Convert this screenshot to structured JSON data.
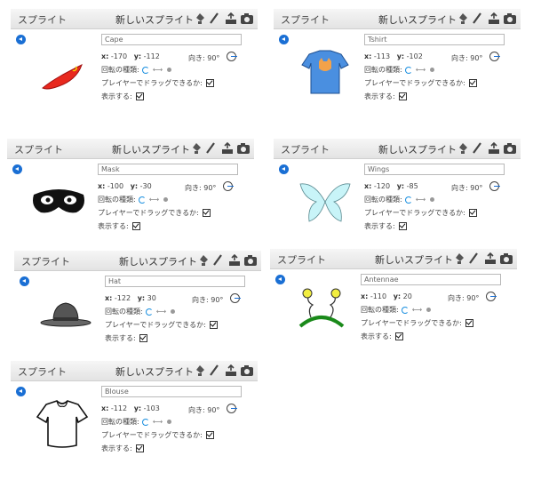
{
  "common": {
    "header_title": "スプライト",
    "new_sprite_label": "新しいスプライト",
    "x_label": "x:",
    "y_label": "y:",
    "direction_label": "向き:",
    "rotation_style_label": "回転の種類:",
    "draggable_label": "プレイヤーでドラッグできるか:",
    "show_label": "表示する:"
  },
  "panels": [
    {
      "name": "Cape",
      "x": "-170",
      "y": "-112",
      "direction": "90°",
      "costume_icon": "red-cape-icon"
    },
    {
      "name": "Tshirt",
      "x": "-113",
      "y": "-102",
      "direction": "90°",
      "costume_icon": "blue-tshirt-icon"
    },
    {
      "name": "Mask",
      "x": "-100",
      "y": "-30",
      "direction": "90°",
      "costume_icon": "black-mask-icon"
    },
    {
      "name": "Wings",
      "x": "-120",
      "y": "-85",
      "direction": "90°",
      "costume_icon": "wings-icon"
    },
    {
      "name": "Hat",
      "x": "-122",
      "y": "30",
      "direction": "90°",
      "costume_icon": "hat-icon"
    },
    {
      "name": "Antennae",
      "x": "-110",
      "y": "20",
      "direction": "90°",
      "costume_icon": "antennae-icon"
    },
    {
      "name": "Blouse",
      "x": "-112",
      "y": "-103",
      "direction": "90°",
      "costume_icon": "blouse-icon"
    }
  ],
  "colors": {
    "accent": "#1a6fd4",
    "cape": "#e8281e",
    "tshirt": "#4a8fe0",
    "wings": "#c8f4f8"
  }
}
